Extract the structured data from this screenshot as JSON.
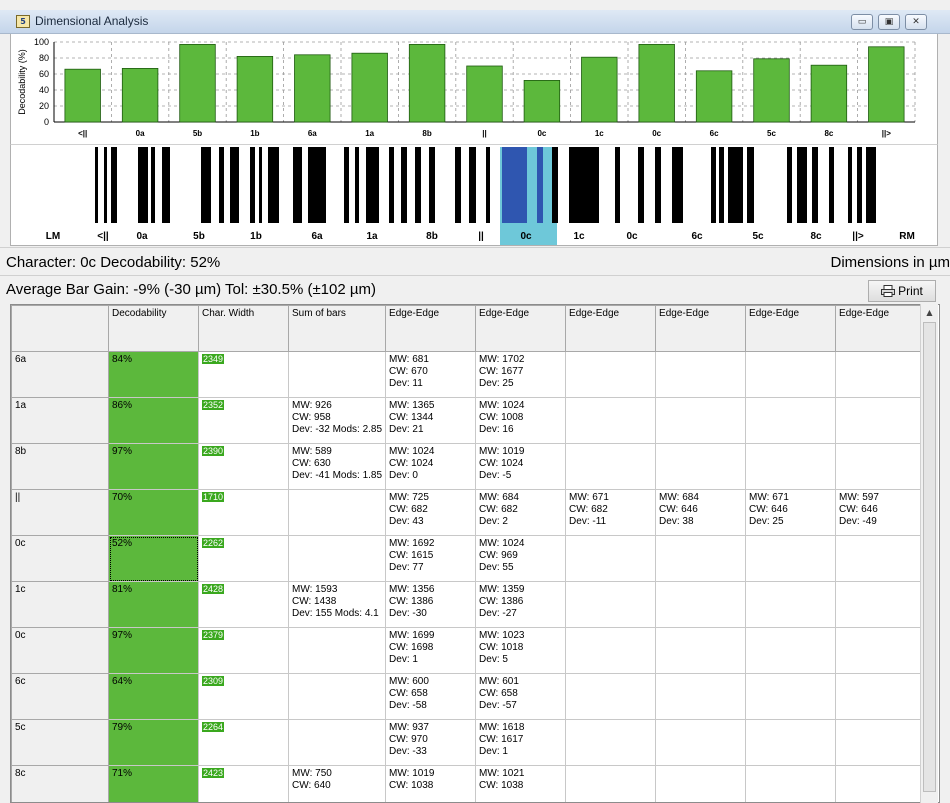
{
  "window": {
    "title": "Dimensional Analysis",
    "app_icon_glyph": "5",
    "controls": [
      {
        "name": "minimize-button",
        "glyph": "▭"
      },
      {
        "name": "maximize-button",
        "glyph": "▣"
      },
      {
        "name": "close-button",
        "glyph": "✕"
      }
    ]
  },
  "chart_data": {
    "type": "bar",
    "ylabel": "Decodability (%)",
    "ylim": [
      0,
      100
    ],
    "yticks": [
      0,
      20,
      40,
      60,
      80,
      100
    ],
    "grid": true,
    "categories": [
      "<||",
      "0a",
      "5b",
      "1b",
      "6a",
      "1a",
      "8b",
      "||",
      "0c",
      "1c",
      "0c",
      "6c",
      "5c",
      "8c",
      "||>"
    ],
    "values": [
      66,
      67,
      97,
      82,
      84,
      86,
      97,
      70,
      52,
      81,
      97,
      64,
      79,
      71,
      94
    ],
    "bar_color": "#5cb83c"
  },
  "barcode": {
    "labels": [
      "LM",
      "<||",
      "0a",
      "5b",
      "1b",
      "6a",
      "1a",
      "8b",
      "||",
      "0c",
      "1c",
      "0c",
      "6c",
      "5c",
      "8c",
      "||>",
      "RM"
    ],
    "selected_label": "0c",
    "selected_colors": {
      "dark": "#2f56b0",
      "light": "#6ec8d9"
    }
  },
  "info": {
    "character": "Character: 0c Decodability: 52%",
    "dimensions": "Dimensions in µm",
    "gain": "Average Bar Gain: -9% (-30 µm) Tol: ±30.5% (±102 µm)",
    "print_label": "Print"
  },
  "table": {
    "headers": [
      "",
      "Decodability",
      "Char. Width",
      "Sum of bars",
      "Edge-Edge",
      "Edge-Edge",
      "Edge-Edge",
      "Edge-Edge",
      "Edge-Edge",
      "Edge-Edge"
    ],
    "rows": [
      {
        "label": "6a",
        "dec": "84%",
        "width": "2349",
        "sum": [],
        "e1": [
          "MW: 681",
          "CW: 670",
          "Dev: 11"
        ],
        "e2": [
          "MW: 1702",
          "CW: 1677",
          "Dev: 25"
        ],
        "e3": [],
        "e4": [],
        "e5": [],
        "e6": []
      },
      {
        "label": "1a",
        "dec": "86%",
        "width": "2352",
        "sum": [
          "MW: 926",
          "CW: 958",
          "Dev: -32 Mods: 2.85"
        ],
        "e1": [
          "MW: 1365",
          "CW: 1344",
          "Dev: 21"
        ],
        "e2": [
          "MW: 1024",
          "CW: 1008",
          "Dev: 16"
        ],
        "e3": [],
        "e4": [],
        "e5": [],
        "e6": []
      },
      {
        "label": "8b",
        "dec": "97%",
        "width": "2390",
        "sum": [
          "MW: 589",
          "CW: 630",
          "Dev: -41 Mods: 1.85"
        ],
        "e1": [
          "MW: 1024",
          "CW: 1024",
          "Dev: 0"
        ],
        "e2": [
          "MW: 1019",
          "CW: 1024",
          "Dev: -5"
        ],
        "e3": [],
        "e4": [],
        "e5": [],
        "e6": []
      },
      {
        "label": "||",
        "dec": "70%",
        "width": "1710",
        "sum": [],
        "e1": [
          "MW: 725",
          "CW: 682",
          "Dev: 43"
        ],
        "e2": [
          "MW: 684",
          "CW: 682",
          "Dev: 2"
        ],
        "e3": [
          "MW: 671",
          "CW: 682",
          "Dev: -11"
        ],
        "e4": [
          "MW: 684",
          "CW: 646",
          "Dev: 38"
        ],
        "e5": [
          "MW: 671",
          "CW: 646",
          "Dev: 25"
        ],
        "e6": [
          "MW: 597",
          "CW: 646",
          "Dev: -49"
        ]
      },
      {
        "label": "0c",
        "dec": "52%",
        "width": "2262",
        "sum": [],
        "e1": [
          "MW: 1692",
          "CW: 1615",
          "Dev: 77"
        ],
        "e2": [
          "MW: 1024",
          "CW: 969",
          "Dev: 55"
        ],
        "e3": [],
        "e4": [],
        "e5": [],
        "e6": []
      },
      {
        "label": "1c",
        "dec": "81%",
        "width": "2428",
        "sum": [
          "MW: 1593",
          "CW: 1438",
          "Dev: 155 Mods: 4.1"
        ],
        "e1": [
          "MW: 1356",
          "CW: 1386",
          "Dev: -30"
        ],
        "e2": [
          "MW: 1359",
          "CW: 1386",
          "Dev: -27"
        ],
        "e3": [],
        "e4": [],
        "e5": [],
        "e6": []
      },
      {
        "label": "0c",
        "dec": "97%",
        "width": "2379",
        "sum": [],
        "e1": [
          "MW: 1699",
          "CW: 1698",
          "Dev: 1"
        ],
        "e2": [
          "MW: 1023",
          "CW: 1018",
          "Dev: 5"
        ],
        "e3": [],
        "e4": [],
        "e5": [],
        "e6": []
      },
      {
        "label": "6c",
        "dec": "64%",
        "width": "2309",
        "sum": [],
        "e1": [
          "MW: 600",
          "CW: 658",
          "Dev: -58"
        ],
        "e2": [
          "MW: 601",
          "CW: 658",
          "Dev: -57"
        ],
        "e3": [],
        "e4": [],
        "e5": [],
        "e6": []
      },
      {
        "label": "5c",
        "dec": "79%",
        "width": "2264",
        "sum": [],
        "e1": [
          "MW: 937",
          "CW: 970",
          "Dev: -33"
        ],
        "e2": [
          "MW: 1618",
          "CW: 1617",
          "Dev: 1"
        ],
        "e3": [],
        "e4": [],
        "e5": [],
        "e6": []
      },
      {
        "label": "8c",
        "dec": "71%",
        "width": "2423",
        "sum": [
          "MW: 750",
          "CW: 640"
        ],
        "e1": [
          "MW: 1019",
          "CW: 1038"
        ],
        "e2": [
          "MW: 1021",
          "CW: 1038"
        ],
        "e3": [],
        "e4": [],
        "e5": [],
        "e6": []
      }
    ]
  }
}
